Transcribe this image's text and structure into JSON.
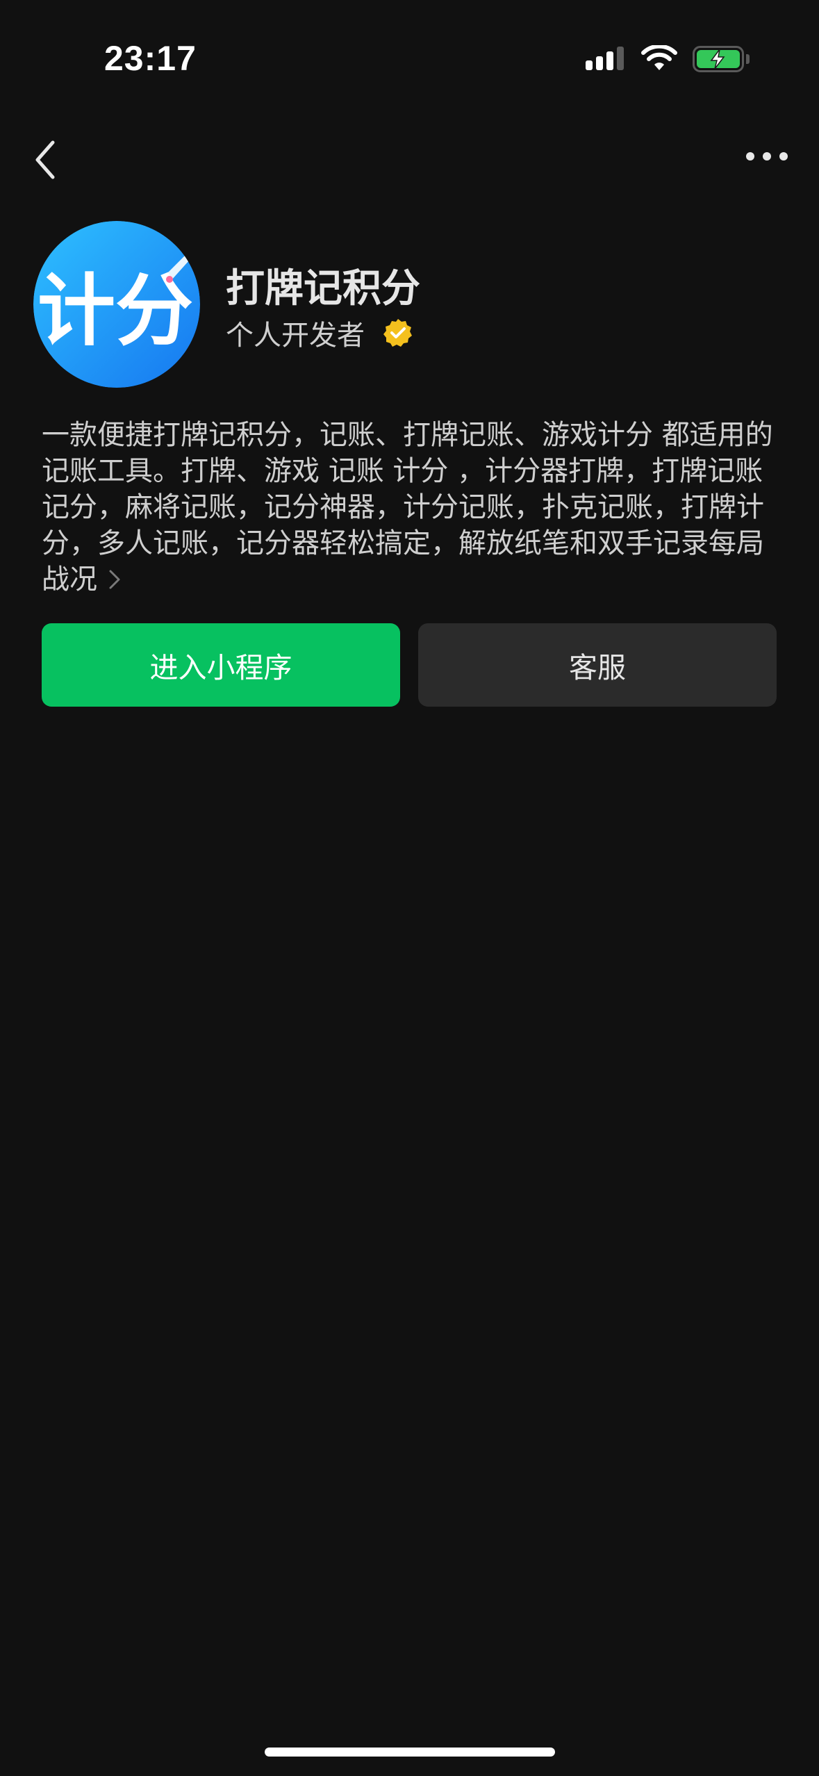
{
  "status_bar": {
    "time": "23:17",
    "icons": [
      "cellular-signal-icon",
      "wifi-icon",
      "battery-charging-icon"
    ],
    "battery_color": "#34c759"
  },
  "nav": {
    "back_icon": "chevron-left-icon",
    "more_icon": "ellipsis-icon"
  },
  "app": {
    "logo_text": "计分",
    "logo_color": "#1aa4f5",
    "name": "打牌记积分",
    "developer": "个人开发者",
    "verified_icon": "verified-badge-icon",
    "verified_color": "#f4c01e",
    "description": "一款便捷打牌记积分，记账、打牌记账、游戏计分 都适用的 记账工具。打牌、游戏 记账 计分 ，计分器打牌，打牌记账记分，麻将记账，记分神器，计分记账，扑克记账，打牌计分，多人记账，记分器轻松搞定，解放纸笔和双手记录每局战况"
  },
  "actions": {
    "primary_label": "进入小程序",
    "secondary_label": "客服",
    "primary_color": "#07c160"
  }
}
